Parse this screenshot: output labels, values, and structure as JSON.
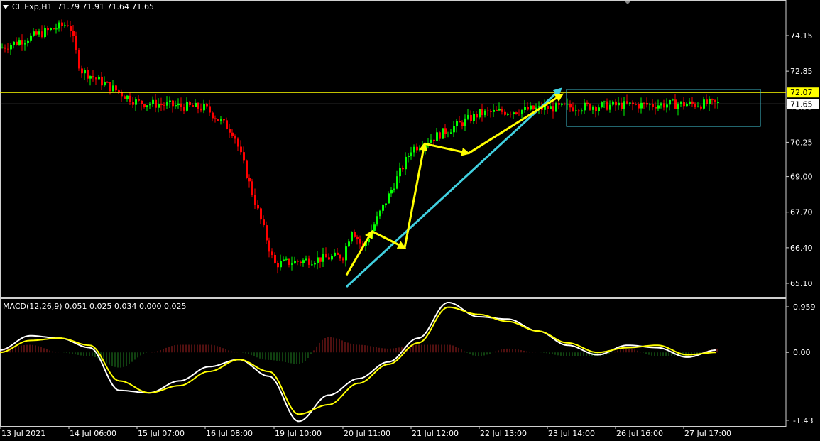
{
  "header": {
    "symbol": "CL.Exp,H1",
    "ohlc": "71.79 71.91 71.64 71.65"
  },
  "macd_header": "MACD(12,26,9) 0.051 0.025 0.034 0.000 0.025",
  "colors": {
    "background": "#000000",
    "bull_candle": "#00ff00",
    "bear_candle": "#ff0000",
    "annotation_arrow": "#ffff00",
    "trend_arrow": "#40d0e0",
    "range_box": "#40c0d0",
    "hline_yellow": "#ffff00",
    "hline_bid": "#a0a0a0",
    "macd_line": "#ffffff",
    "signal_line": "#ffff00",
    "hist_pos": "#a02020",
    "hist_neg": "#208020"
  },
  "chart_data": [
    {
      "type": "candlestick",
      "title": "CL.Exp,H1",
      "timeframe": "H1",
      "ylim": [
        64.5,
        75.3
      ],
      "y_ticks": [
        "74.15",
        "72.85",
        "71.55",
        "70.25",
        "69.00",
        "67.70",
        "66.40",
        "65.10"
      ],
      "x_ticks": [
        "13 Jul 2021",
        "14 Jul 06:00",
        "15 Jul 07:00",
        "16 Jul 08:00",
        "19 Jul 10:00",
        "20 Jul 11:00",
        "21 Jul 12:00",
        "22 Jul 13:00",
        "23 Jul 14:00",
        "26 Jul 16:00",
        "27 Jul 17:00"
      ],
      "last_ohlc": {
        "open": 71.79,
        "high": 71.91,
        "low": 71.64,
        "close": 71.65
      },
      "close_path": [
        {
          "x": "13 Jul 2021",
          "close": 73.7
        },
        {
          "x": "14 Jul 06:00",
          "close": 74.6
        },
        {
          "x": "14 Jul 10:00",
          "close": 72.9
        },
        {
          "x": "15 Jul 07:00",
          "close": 71.7
        },
        {
          "x": "16 Jul 08:00",
          "close": 71.5
        },
        {
          "x": "16 Jul 18:00",
          "close": 70.6
        },
        {
          "x": "19 Jul 10:00",
          "close": 65.8
        },
        {
          "x": "20 Jul 11:00",
          "close": 66.1
        },
        {
          "x": "20 Jul 14:00",
          "close": 67.1
        },
        {
          "x": "20 Jul 18:00",
          "close": 66.4
        },
        {
          "x": "21 Jul 12:00",
          "close": 70.0
        },
        {
          "x": "22 Jul 13:00",
          "close": 71.3
        },
        {
          "x": "23 Jul 14:00",
          "close": 71.5
        },
        {
          "x": "26 Jul 16:00",
          "close": 71.6
        },
        {
          "x": "27 Jul 17:00",
          "close": 71.65
        }
      ],
      "hlines": [
        {
          "value": 72.07,
          "label": "72.07",
          "color": "#ffff00"
        },
        {
          "value": 71.65,
          "label": "71.65",
          "color": "#a0a0a0"
        }
      ],
      "annotations": {
        "range_box": {
          "x_start": "23 Jul 14:00",
          "x_end": "27 Jul 22:00",
          "y_top": 72.18,
          "y_bottom": 70.83
        },
        "trend_arrow": {
          "from": {
            "x": "20 Jul 11:00",
            "y": 65.0
          },
          "to": {
            "x": "23 Jul 14:00",
            "y": 72.1
          }
        },
        "yellow_arrows": [
          {
            "from": {
              "x": "20 Jul 11:00",
              "y": 65.4
            },
            "to": {
              "x": "20 Jul 14:00",
              "y": 67.0
            }
          },
          {
            "from": {
              "x": "20 Jul 14:00",
              "y": 67.0
            },
            "to": {
              "x": "20 Jul 18:00",
              "y": 66.4
            }
          },
          {
            "from": {
              "x": "20 Jul 18:00",
              "y": 66.4
            },
            "to": {
              "x": "21 Jul 12:00",
              "y": 70.2
            }
          },
          {
            "from": {
              "x": "21 Jul 12:00",
              "y": 70.2
            },
            "to": {
              "x": "21 Jul 18:00",
              "y": 69.85
            }
          },
          {
            "from": {
              "x": "21 Jul 18:00",
              "y": 69.85
            },
            "to": {
              "x": "23 Jul 14:00",
              "y": 72.0
            }
          }
        ]
      }
    },
    {
      "type": "line",
      "title": "MACD(12,26,9) 0.051 0.025 0.034 0.000 0.025",
      "ylim": [
        -1.5,
        1.05
      ],
      "y_ticks": [
        "0.959",
        "0.00",
        "-1.43"
      ],
      "series": [
        {
          "name": "MACD",
          "color": "#ffffff",
          "values": [
            0.05,
            0.35,
            0.3,
            0.1,
            -0.8,
            -0.85,
            -0.6,
            -0.3,
            -0.15,
            -0.5,
            -1.45,
            -0.9,
            -0.55,
            -0.2,
            0.3,
            1.05,
            0.75,
            0.7,
            0.45,
            0.15,
            -0.05,
            0.15,
            0.1,
            -0.1,
            0.05
          ]
        },
        {
          "name": "Signal",
          "color": "#ffff00",
          "values": [
            0.0,
            0.25,
            0.3,
            0.15,
            -0.6,
            -0.85,
            -0.7,
            -0.4,
            -0.15,
            -0.4,
            -1.3,
            -1.1,
            -0.65,
            -0.25,
            0.2,
            0.95,
            0.8,
            0.65,
            0.45,
            0.2,
            0.0,
            0.1,
            0.15,
            -0.05,
            0.0
          ]
        }
      ],
      "histogram_hint": "positive bars red, negative bars green"
    }
  ]
}
